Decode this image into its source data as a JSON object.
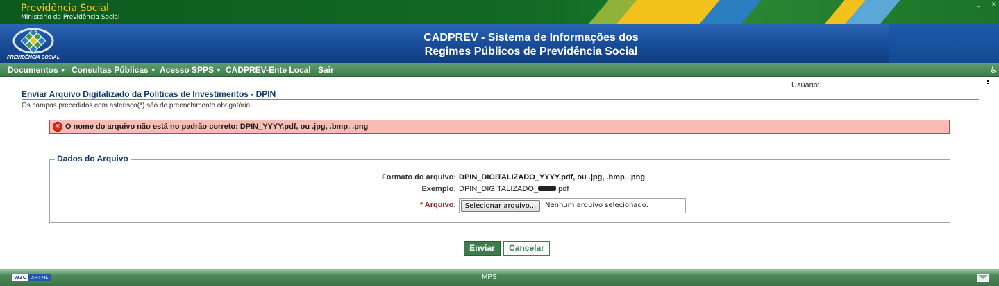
{
  "header": {
    "org_name": "Previdência Social",
    "org_subtitle": "Ministério da Previdência Social",
    "logo_text": "PREVIDÊNCIA SOCIAL",
    "system_title_line1": "CADPREV - Sistema de Informações dos",
    "system_title_line2": "Regimes Públicos de Previdência Social"
  },
  "menu": {
    "items": [
      {
        "label": "Documentos",
        "has_dropdown": true
      },
      {
        "label": "Consultas Públicas",
        "has_dropdown": true
      },
      {
        "label": "Acesso SPPS",
        "has_dropdown": true
      },
      {
        "label": "CADPREV-Ente Local",
        "has_dropdown": false
      },
      {
        "label": "Sair",
        "has_dropdown": false
      }
    ],
    "accessibility_icon": "wheelchair-icon"
  },
  "page": {
    "title": "Enviar Arquivo Digitalizado da Políticas de Investimentos - DPIN",
    "user_label": "Usuário:",
    "required_note": "Os campos precedidos com asterisco(*) são de preenchimento obrigatório."
  },
  "error": {
    "icon": "error-circle-icon",
    "message": "O nome do arquivo não está no padrão correto: DPIN_YYYY.pdf, ou .jpg, .bmp, .png"
  },
  "form": {
    "legend": "Dados do Arquivo",
    "format_label": "Formato do arquivo:",
    "format_value": "DPIN_DIGITALIZADO_YYYY.pdf, ou .jpg, .bmp, .png",
    "example_label": "Exemplo:",
    "example_prefix": "DPIN_DIGITALIZADO_",
    "example_suffix": ".pdf",
    "file_required_mark": "*",
    "file_label": "Arquivo:",
    "file_button": "Selecionar arquivo...",
    "file_status": "Nenhum arquivo selecionado."
  },
  "actions": {
    "send": "Enviar",
    "cancel": "Cancelar"
  },
  "footer": {
    "badge_left": "W3C",
    "badge_right": "XHTML",
    "text": "MPS",
    "mail_icon": "envelope-icon"
  },
  "colors": {
    "menu_green": "#3d7d4b",
    "header_blue": "#1a4f9c",
    "error_background": "#f8bcb4",
    "title_blue": "#123a6e"
  }
}
